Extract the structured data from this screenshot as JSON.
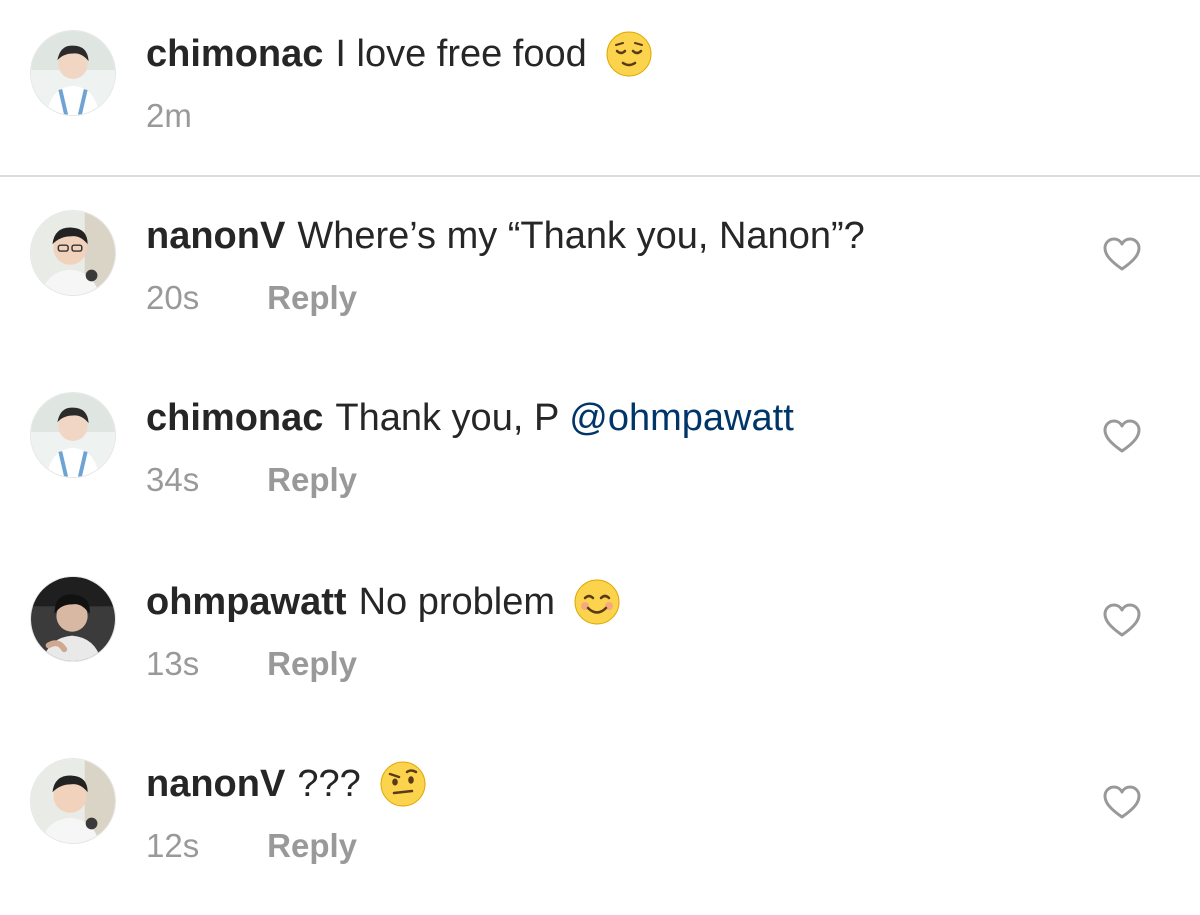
{
  "caption": {
    "username": "chimonac",
    "text": "I love free food",
    "emoji": "relieved-face-emoji",
    "time": "2m"
  },
  "comments": [
    {
      "username": "nanonV",
      "text": "Where’s my “Thank you, Nanon”?",
      "mention": "",
      "emoji": "",
      "time": "20s",
      "reply_label": "Reply",
      "icon": "heart-icon"
    },
    {
      "username": "chimonac",
      "text": "Thank you, P",
      "mention": "@ohmpawatt",
      "emoji": "",
      "time": "34s",
      "reply_label": "Reply",
      "icon": "heart-icon"
    },
    {
      "username": "ohmpawatt",
      "text": "No problem",
      "mention": "",
      "emoji": "smiling-face-emoji",
      "time": "13s",
      "reply_label": "Reply",
      "icon": "heart-icon"
    },
    {
      "username": "nanonV",
      "text": "???",
      "mention": "",
      "emoji": "raised-eyebrow-emoji",
      "time": "12s",
      "reply_label": "Reply",
      "icon": "heart-icon"
    }
  ],
  "colors": {
    "text": "#262626",
    "secondary": "#999999",
    "link": "#003569",
    "divider": "#dbdbdb"
  }
}
